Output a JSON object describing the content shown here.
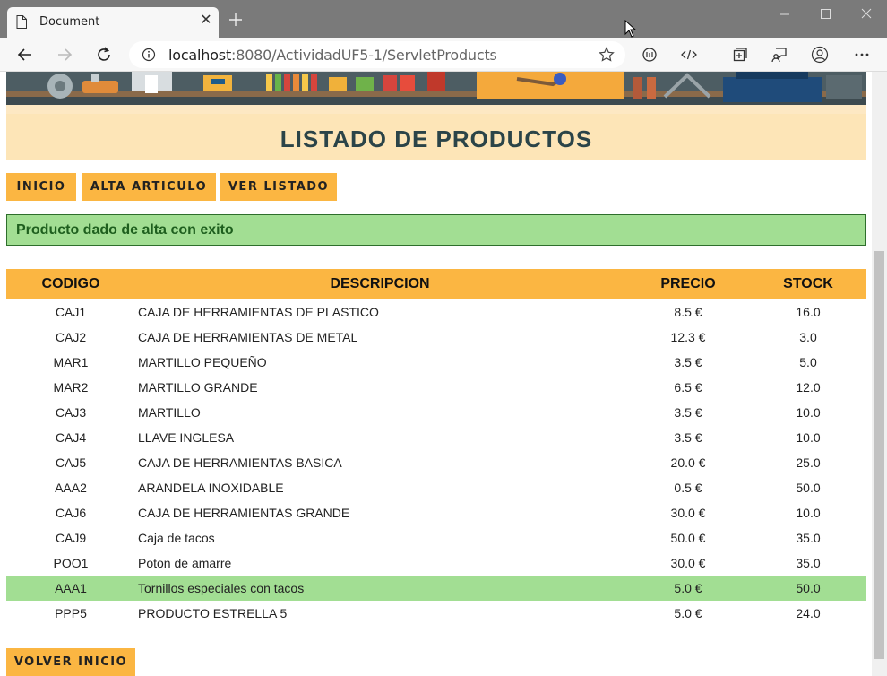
{
  "browser": {
    "tab_title": "Document",
    "url_host": "localhost",
    "url_path": ":8080/ActividadUF5-1/ServletProducts"
  },
  "page": {
    "title": "LISTADO DE PRODUCTOS",
    "nav": {
      "inicio": "INICIO",
      "alta": "ALTA ARTICULO",
      "listado": "VER LISTADO"
    },
    "alert": "Producto dado de alta con exito",
    "table": {
      "headers": {
        "code": "CODIGO",
        "desc": "DESCRIPCION",
        "price": "PRECIO",
        "stock": "STOCK"
      },
      "rows": [
        {
          "code": "CAJ1",
          "desc": "CAJA DE HERRAMIENTAS DE PLASTICO",
          "price": "8.5 €",
          "stock": "16.0"
        },
        {
          "code": "CAJ2",
          "desc": "CAJA DE HERRAMIENTAS DE METAL",
          "price": "12.3 €",
          "stock": "3.0"
        },
        {
          "code": "MAR1",
          "desc": "MARTILLO PEQUEÑO",
          "price": "3.5 €",
          "stock": "5.0"
        },
        {
          "code": "MAR2",
          "desc": "MARTILLO GRANDE",
          "price": "6.5 €",
          "stock": "12.0"
        },
        {
          "code": "CAJ3",
          "desc": "MARTILLO",
          "price": "3.5 €",
          "stock": "10.0"
        },
        {
          "code": "CAJ4",
          "desc": "LLAVE INGLESA",
          "price": "3.5 €",
          "stock": "10.0"
        },
        {
          "code": "CAJ5",
          "desc": "CAJA DE HERRAMIENTAS BASICA",
          "price": "20.0 €",
          "stock": "25.0"
        },
        {
          "code": "AAA2",
          "desc": "ARANDELA INOXIDABLE",
          "price": "0.5 €",
          "stock": "50.0"
        },
        {
          "code": "CAJ6",
          "desc": "CAJA DE HERRAMIENTAS GRANDE",
          "price": "30.0 €",
          "stock": "10.0"
        },
        {
          "code": "CAJ9",
          "desc": "Caja de tacos",
          "price": "50.0 €",
          "stock": "35.0"
        },
        {
          "code": "POO1",
          "desc": "Poton de amarre",
          "price": "30.0 €",
          "stock": "35.0"
        },
        {
          "code": "AAA1",
          "desc": "Tornillos especiales con tacos",
          "price": "5.0 €",
          "stock": "50.0",
          "highlighted": true
        },
        {
          "code": "PPP5",
          "desc": "PRODUCTO ESTRELLA 5",
          "price": "5.0 €",
          "stock": "24.0"
        }
      ]
    },
    "back_button": "VOLVER INICIO"
  },
  "colors": {
    "accent": "#fbb642",
    "hero_bg": "#fde5b7",
    "title_text": "#2b4448",
    "success_bg": "#a2de93",
    "success_text": "#1e5f1e"
  }
}
